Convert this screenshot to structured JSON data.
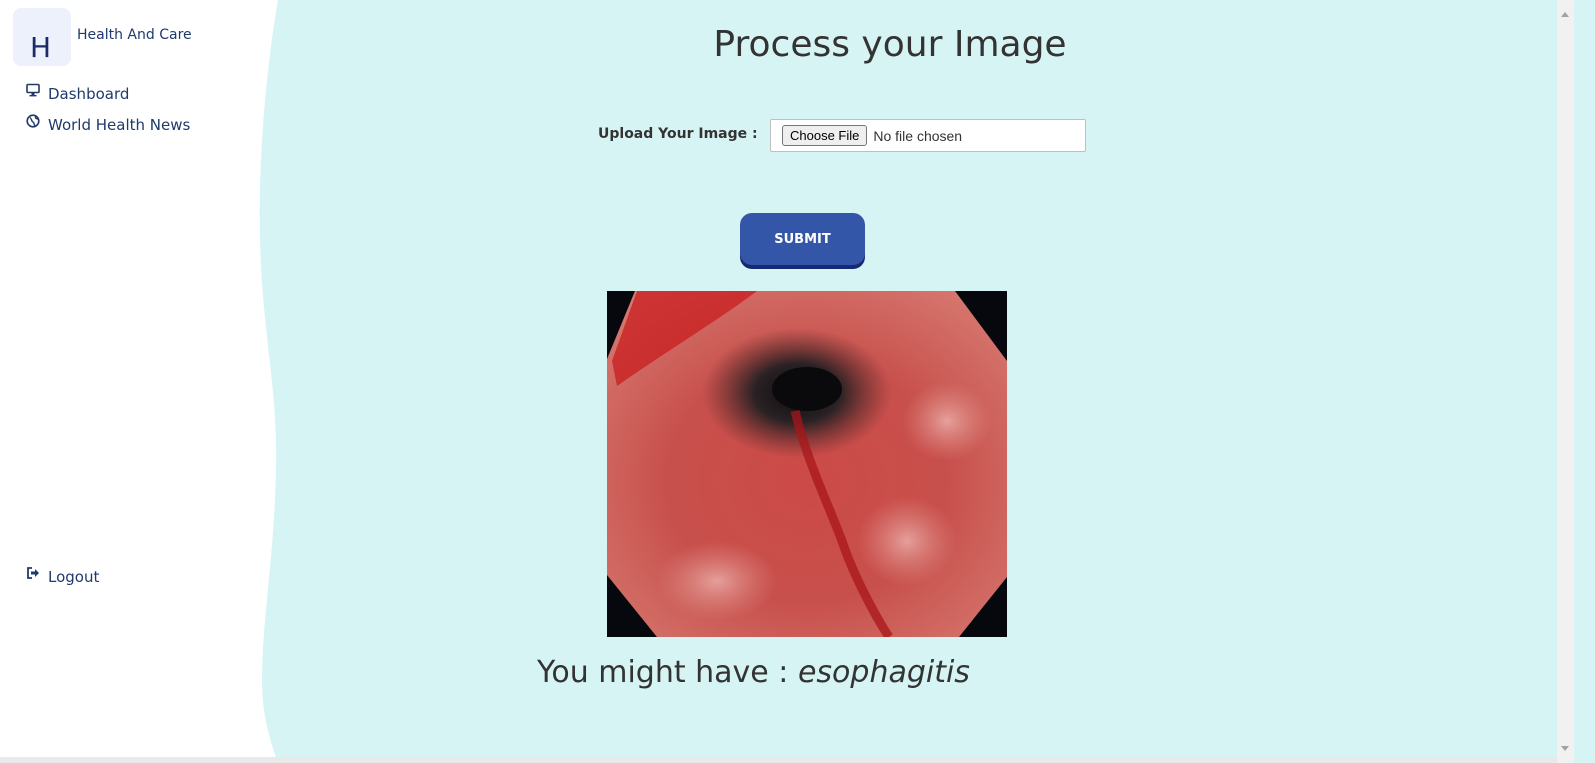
{
  "sidebar": {
    "logo_letter": "H",
    "brand_name": "Health And Care",
    "nav": [
      {
        "label": "Dashboard",
        "icon": "monitor-icon"
      },
      {
        "label": "World Health News",
        "icon": "globe-icon"
      }
    ],
    "logout": {
      "label": "Logout",
      "icon": "logout-icon"
    }
  },
  "main": {
    "title": "Process your Image",
    "upload_label": "Upload Your Image :",
    "file_button": "Choose File",
    "file_status": "No file chosen",
    "submit": "SUBMIT",
    "result_prefix": "You might have : ",
    "result_diagnosis": "esophagitis"
  },
  "colors": {
    "page_bg": "#d7f4f4",
    "sidebar_bg": "#ffffff",
    "nav_text": "#1f3a6b",
    "submit_bg": "#3456a8"
  }
}
